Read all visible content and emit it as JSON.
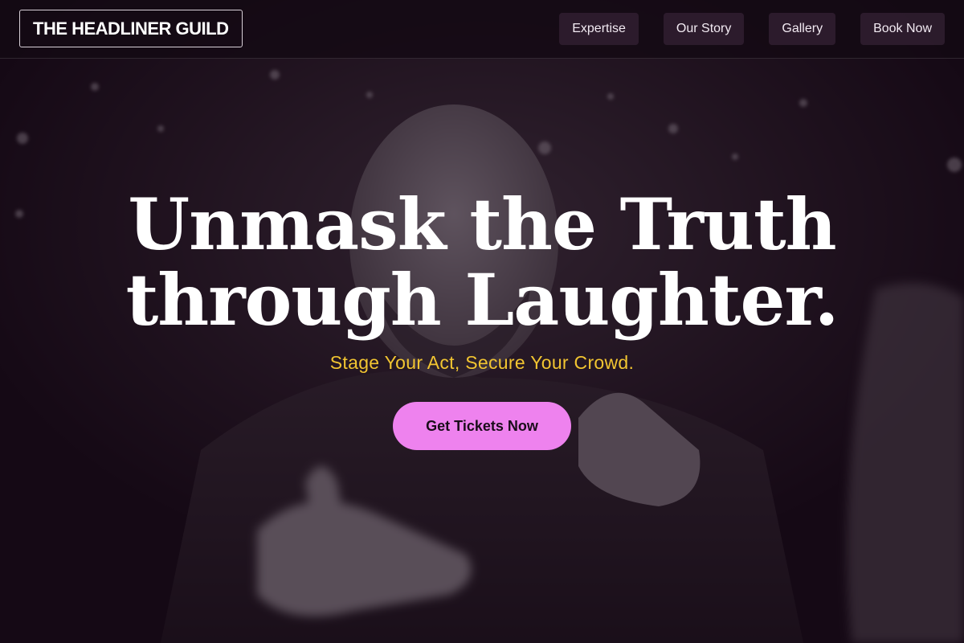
{
  "header": {
    "logo_text": "THE HEADLINER GUILD",
    "nav": [
      {
        "label": "Expertise"
      },
      {
        "label": "Our Story"
      },
      {
        "label": "Gallery"
      },
      {
        "label": "Book Now"
      }
    ]
  },
  "hero": {
    "title_line_1": "Unmask the Truth",
    "title_line_2": "through Laughter.",
    "tagline": "Stage Your Act, Secure Your Crowd.",
    "cta_label": "Get Tickets Now",
    "background_image": "comedian-pointing-photo"
  },
  "colors": {
    "background": "#140a14",
    "accent_pink": "#ee82ee",
    "tagline_gold": "#f2c531",
    "text": "#ffffff"
  }
}
